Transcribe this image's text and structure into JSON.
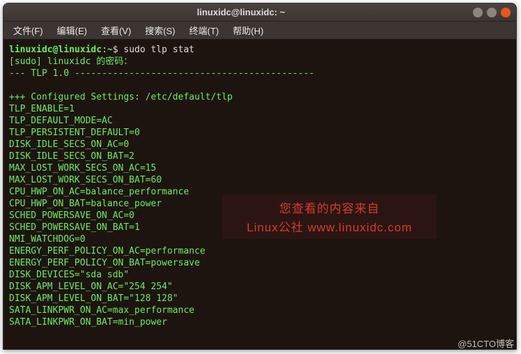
{
  "titlebar": {
    "title": "linuxidc@linuxidc: ~"
  },
  "menus": {
    "file": "文件(F)",
    "edit": "编辑(E)",
    "view": "查看(V)",
    "search": "搜索(S)",
    "terminal": "终端(T)",
    "help": "帮助(H)"
  },
  "prompt": {
    "user_host": "linuxidc@linuxidc",
    "sep1": ":",
    "path": "~",
    "sep2": "$ ",
    "command": "sudo tlp stat"
  },
  "sudo_line": "[sudo] linuxidc 的密码：",
  "tlp_header": "--- TLP 1.0 --------------------------------------------",
  "config_header": "+++ Configured Settings: /etc/default/tlp",
  "lines": [
    "TLP_ENABLE=1",
    "TLP_DEFAULT_MODE=AC",
    "TLP_PERSISTENT_DEFAULT=0",
    "DISK_IDLE_SECS_ON_AC=0",
    "DISK_IDLE_SECS_ON_BAT=2",
    "MAX_LOST_WORK_SECS_ON_AC=15",
    "MAX_LOST_WORK_SECS_ON_BAT=60",
    "CPU_HWP_ON_AC=balance_performance",
    "CPU_HWP_ON_BAT=balance_power",
    "SCHED_POWERSAVE_ON_AC=0",
    "SCHED_POWERSAVE_ON_BAT=1",
    "NMI_WATCHDOG=0",
    "ENERGY_PERF_POLICY_ON_AC=performance",
    "ENERGY_PERF_POLICY_ON_BAT=powersave",
    "DISK_DEVICES=\"sda sdb\"",
    "DISK_APM_LEVEL_ON_AC=\"254 254\"",
    "DISK_APM_LEVEL_ON_BAT=\"128 128\"",
    "SATA_LINKPWR_ON_AC=max_performance",
    "SATA_LINKPWR_ON_BAT=min_power"
  ],
  "watermark": {
    "line1": "您查看的内容来自",
    "line2": "Linux公社 www.linuxidc.com"
  },
  "footer": "@51CTO博客"
}
